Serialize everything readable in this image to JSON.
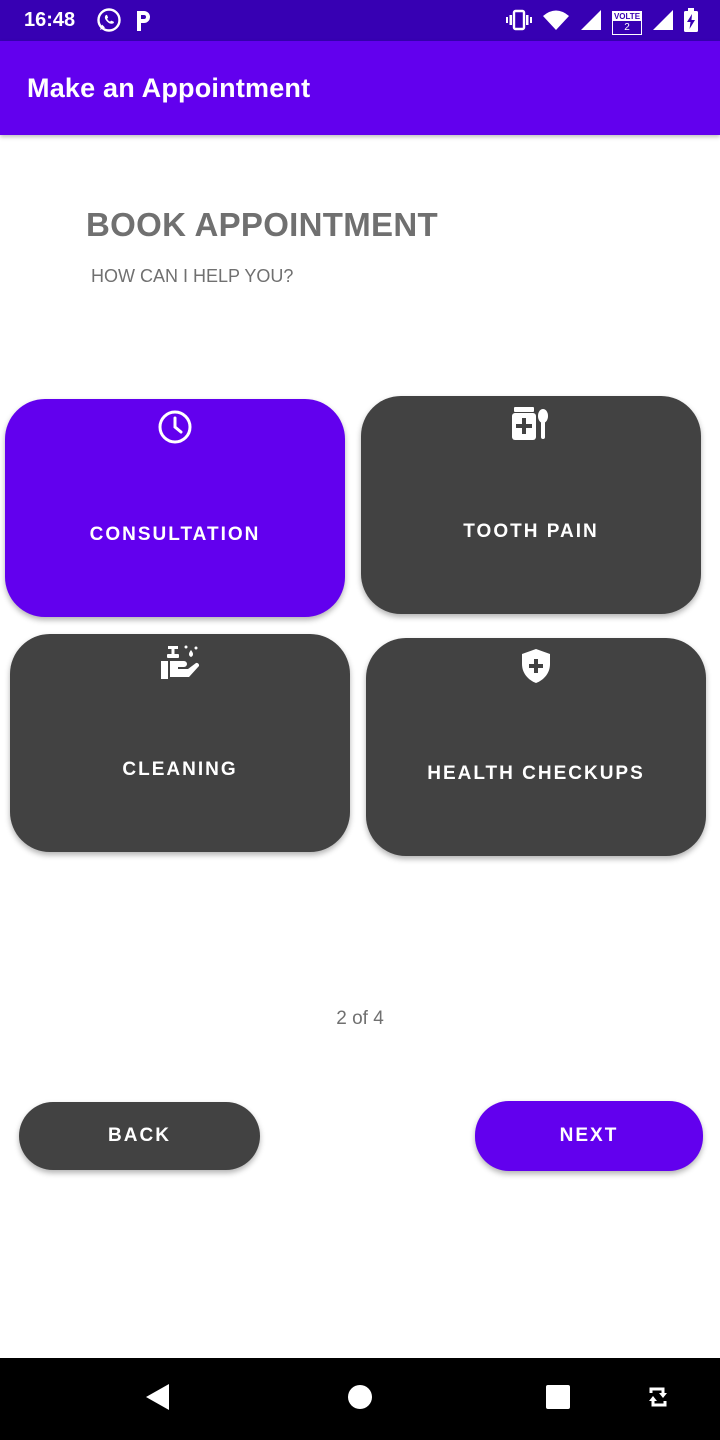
{
  "status_bar": {
    "time": "16:48",
    "left_icons": [
      "whatsapp-icon",
      "p-app-icon"
    ],
    "right_icons": [
      "vibrate-icon",
      "wifi-icon",
      "signal-icon",
      "volte-icon",
      "signal-icon",
      "battery-charging-icon"
    ],
    "volte_label": "VOLTE",
    "sim_number": "2"
  },
  "app_bar": {
    "title": "Make an Appointment"
  },
  "main": {
    "heading": "BOOK APPOINTMENT",
    "subheading": "HOW CAN I HELP YOU?",
    "options": [
      {
        "label": "CONSULTATION",
        "icon": "clock-icon",
        "selected": true
      },
      {
        "label": "TOOTH PAIN",
        "icon": "medicine-icon",
        "selected": false
      },
      {
        "label": "CLEANING",
        "icon": "hand-wash-icon",
        "selected": false
      },
      {
        "label": "HEALTH CHECKUPS",
        "icon": "health-shield-icon",
        "selected": false
      }
    ],
    "page_indicator": "2 of 4"
  },
  "buttons": {
    "back": "BACK",
    "next": "NEXT"
  },
  "nav_bar": {
    "icons": [
      "back-triangle-icon",
      "home-circle-icon",
      "recents-square-icon",
      "rotate-icon"
    ]
  },
  "colors": {
    "primary": "#6200ee",
    "primary_dark": "#3700b3",
    "card": "#424242",
    "text_muted": "#707070"
  }
}
